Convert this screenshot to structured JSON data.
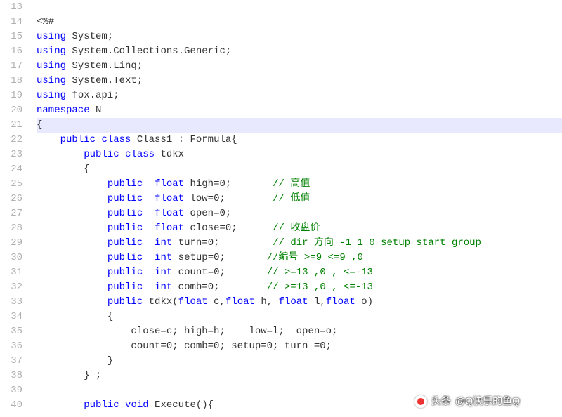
{
  "startLine": 13,
  "highlightedLine": 21,
  "lines": [
    "",
    "<%#",
    "using System;",
    "using System.Collections.Generic;",
    "using System.Linq;",
    "using System.Text;",
    "using fox.api;",
    "namespace N",
    "{",
    "    public class Class1 : Formula{",
    "        public class tdkx",
    "        {",
    "            public  float high=0;       // 高值",
    "            public  float low=0;        // 低值",
    "            public  float open=0;",
    "            public  float close=0;      // 收盘价",
    "            public  int turn=0;         // dir 方向 -1 1 0 setup start group",
    "            public  int setup=0;       //编号 >=9 <=9 ,0",
    "            public  int count=0;       // >=13 ,0 , <=-13",
    "            public  int comb=0;        // >=13 ,0 , <=-13",
    "            public tdkx(float c,float h, float l,float o)",
    "            {",
    "                close=c; high=h;    low=l;  open=o;",
    "                count=0; comb=0; setup=0; turn =0;",
    "            }",
    "        } ;",
    "",
    "        public void Execute(){"
  ],
  "watermark": {
    "prefix": "头条",
    "author": "@Q快乐的鱼Q"
  }
}
